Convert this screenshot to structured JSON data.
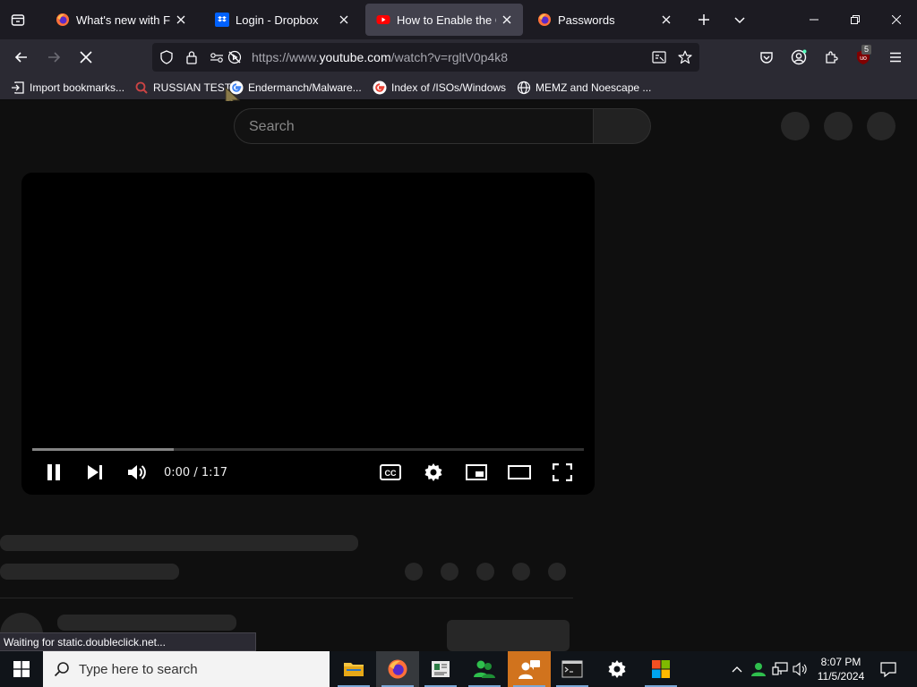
{
  "tabs": [
    {
      "title": "What's new with Firefox",
      "icon": "firefox-icon",
      "active": false
    },
    {
      "title": "Login - Dropbox",
      "icon": "dropbox-icon",
      "active": false
    },
    {
      "title": "How to Enable the On-Screen Keyboard",
      "icon": "youtube-icon",
      "active": true
    },
    {
      "title": "Passwords",
      "icon": "firefox-icon",
      "active": false
    }
  ],
  "nav": {
    "url_prefix": "https://www.",
    "url_domain": "youtube.com",
    "url_path": "/watch?v=rgltV0p4k8",
    "extension_badge": "5"
  },
  "bookmarks": [
    {
      "label": "Import bookmarks...",
      "icon": "import-icon"
    },
    {
      "label": "RUSSIAN TEST",
      "icon": "magnifier-icon"
    },
    {
      "label": "Endermanch/Malware...",
      "icon": "google-icon"
    },
    {
      "label": "Index of /ISOs/Windows",
      "icon": "google-icon"
    },
    {
      "label": "MEMZ and Noescape ...",
      "icon": "globe-icon"
    }
  ],
  "page": {
    "search_placeholder": "Search",
    "player": {
      "time_display": "0:00 / 1:17",
      "progress_fraction": 0.257,
      "controls": [
        "pause",
        "next",
        "volume",
        "captions",
        "settings",
        "miniplayer",
        "theater",
        "fullscreen"
      ]
    }
  },
  "status_text": "Waiting for static.doubleclick.net...",
  "taskbar": {
    "search_placeholder": "Type here to search",
    "time": "8:07 PM",
    "date": "11/5/2024",
    "apps": [
      "file-explorer-icon",
      "firefox-icon",
      "news-icon",
      "people-icon",
      "contacts-icon",
      "terminal-icon",
      "settings-icon",
      "store-icon"
    ]
  },
  "colors": {
    "youtube_red": "#ff0000",
    "dropbox_blue": "#0061fe",
    "taskbar_highlight": "#d1731d"
  }
}
